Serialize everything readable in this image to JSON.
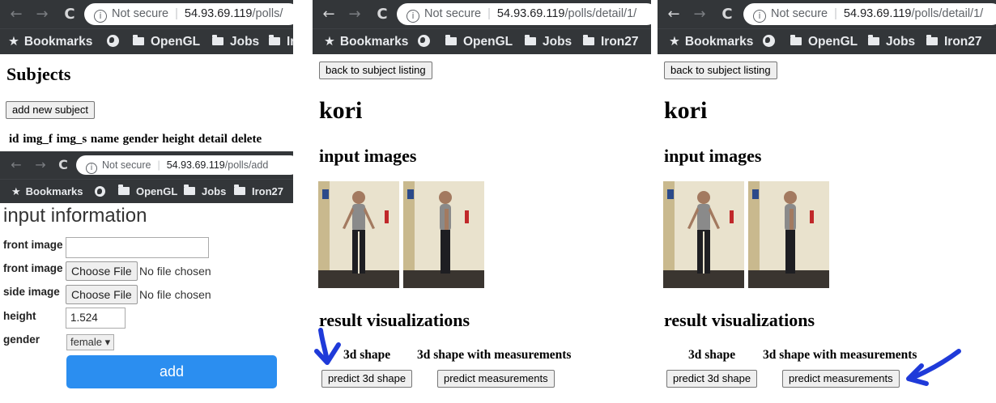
{
  "subjects_panel": {
    "nav": {
      "back": "←",
      "forward": "→",
      "reload": "C"
    },
    "address": {
      "security": "Not secure",
      "host": "54.93.69.119",
      "path": "/polls/"
    },
    "bookmarks": [
      "Bookmarks",
      "OpenGL",
      "Jobs",
      "Ir"
    ],
    "heading": "Subjects",
    "add_button": "add new subject",
    "table_header": "id img_f img_s name gender height detail delete"
  },
  "add_panel": {
    "nav": {
      "back": "←",
      "forward": "→",
      "reload": "C"
    },
    "address": {
      "security": "Not secure",
      "host": "54.93.69.119",
      "path": "/polls/add"
    },
    "bookmarks": [
      "Bookmarks",
      "OpenGL",
      "Jobs",
      "Iron27"
    ],
    "title": "input information",
    "fields": {
      "front_image_label": "front image",
      "front_image_value": "",
      "front_image2_label": "front image",
      "side_image_label": "side image",
      "choose_file": "Choose File",
      "no_file": "No file chosen",
      "height_label": "height",
      "height_value": "1.524",
      "gender_label": "gender",
      "gender_value": "female ▾"
    },
    "submit": "add"
  },
  "detail_panel_a": {
    "nav": {
      "back": "←",
      "forward": "→",
      "reload": "C"
    },
    "address": {
      "security": "Not secure",
      "host": "54.93.69.119",
      "path": "/polls/detail/1/"
    },
    "bookmarks": [
      "Bookmarks",
      "OpenGL",
      "Jobs",
      "Iron27"
    ],
    "back_button": "back to subject listing",
    "name": "kori",
    "input_images_title": "input images",
    "result_title": "result visualizations",
    "col1_label": "3d shape",
    "col2_label": "3d shape with measurements",
    "predict_shape": "predict 3d shape",
    "predict_measurements": "predict measurements"
  },
  "detail_panel_b": {
    "nav": {
      "back": "←",
      "forward": "→",
      "reload": "C"
    },
    "address": {
      "security": "Not secure",
      "host": "54.93.69.119",
      "path": "/polls/detail/1/"
    },
    "bookmarks": [
      "Bookmarks",
      "OpenGL",
      "Jobs",
      "Iron27"
    ],
    "back_button": "back to subject listing",
    "name": "kori",
    "input_images_title": "input images",
    "result_title": "result visualizations",
    "col1_label": "3d shape",
    "col2_label": "3d shape with measurements",
    "predict_shape": "predict 3d shape",
    "predict_measurements": "predict measurements"
  },
  "colors": {
    "chrome_bar": "#333639",
    "submit_button": "#2b8ef0",
    "annotation_arrow": "#1f3ad9"
  }
}
